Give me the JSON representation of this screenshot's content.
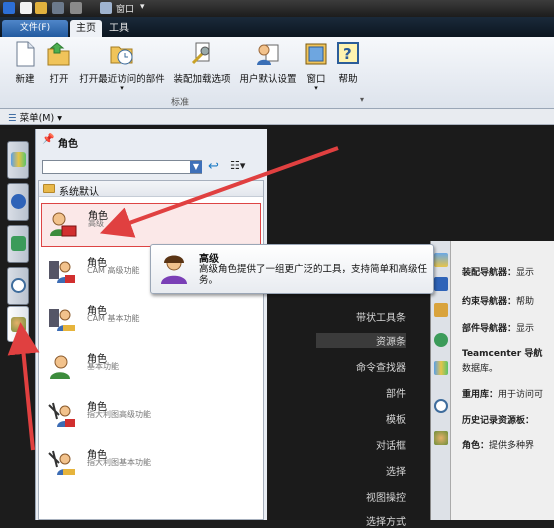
{
  "quick_access": {
    "window_menu": "窗口"
  },
  "tabs": {
    "file": "文件(F)",
    "home": "主页",
    "tools": "工具"
  },
  "ribbon": {
    "buttons": [
      {
        "label": "新建",
        "icon": "new-document-icon"
      },
      {
        "label": "打开",
        "icon": "open-folder-icon"
      },
      {
        "label": "打开最近访问的部件",
        "icon": "recent-parts-icon"
      },
      {
        "label": "装配加载选项",
        "icon": "assembly-load-options-icon"
      },
      {
        "label": "用户默认设置",
        "icon": "user-defaults-icon"
      },
      {
        "label": "窗口",
        "icon": "window-icon"
      },
      {
        "label": "帮助",
        "icon": "help-icon"
      }
    ],
    "group_label": "标准"
  },
  "menubar": {
    "menu_label": "菜单(M)"
  },
  "panel": {
    "title": "角色",
    "folder": "系统默认",
    "roles": [
      {
        "name": "角色",
        "sub": "高级"
      },
      {
        "name": "角色",
        "sub": "CAM 高级功能"
      },
      {
        "name": "角色",
        "sub": "CAM 基本功能"
      },
      {
        "name": "角色",
        "sub": "基本功能"
      },
      {
        "name": "角色",
        "sub": "指大利图高级功能"
      },
      {
        "name": "角色",
        "sub": "指大利图基本功能"
      }
    ]
  },
  "tooltip": {
    "title": "高级",
    "body": "高级角色提供了一组更广泛的工具，支持简单和高级任务。"
  },
  "workspace": {
    "menu_items": [
      "带状工具条",
      "资源条",
      "命令查找器",
      "部件",
      "模板",
      "对话框",
      "选择",
      "视图操控",
      "选择方式"
    ],
    "right_panel": [
      {
        "label": "装配导航器：",
        "text": "显示"
      },
      {
        "label": "约束导航器：",
        "text": "帮助"
      },
      {
        "label": "部件导航器：",
        "text": "显示"
      },
      {
        "label": "Teamcenter 导航",
        "text": ""
      },
      {
        "label": "",
        "text": "数据库。"
      },
      {
        "label": "重用库：",
        "text": "用于访问可"
      },
      {
        "label": "历史记录资源板：",
        "text": ""
      },
      {
        "label": "角色：",
        "text": "提供多种界"
      }
    ]
  },
  "colors": {
    "selection_border": "#dd4444",
    "arrow": "#e04040",
    "file_tab": "#3a74bd"
  }
}
